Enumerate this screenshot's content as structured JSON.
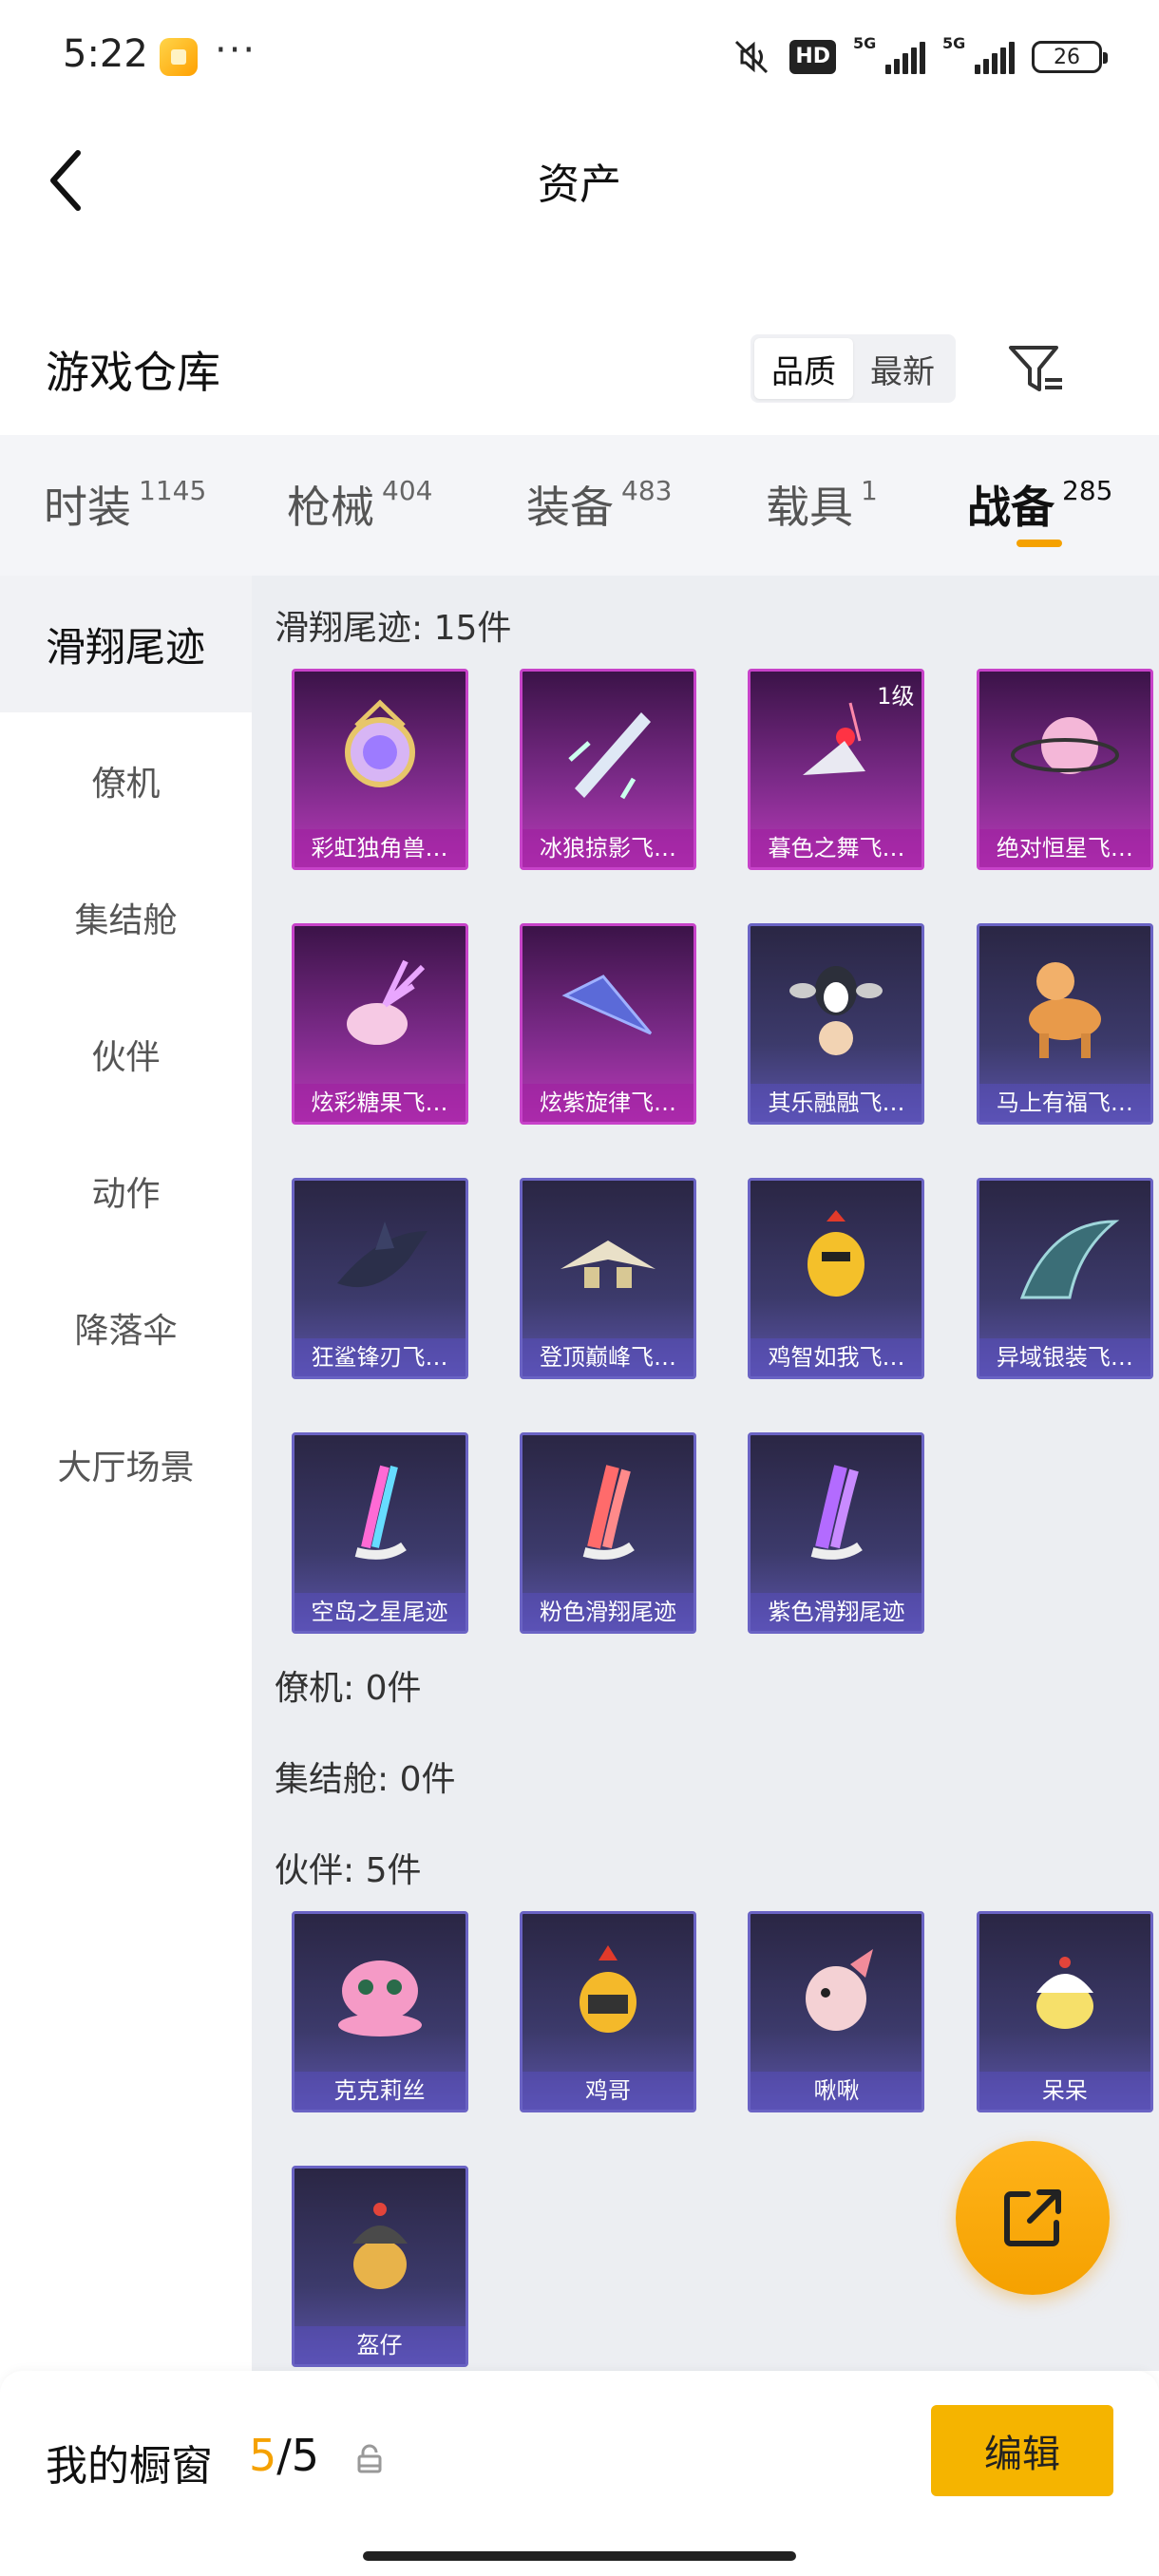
{
  "status_bar": {
    "time": "5:22",
    "dots": "···",
    "hd": "HD",
    "net1": "5G",
    "net2": "5G",
    "battery": "26"
  },
  "header": {
    "title": "资产"
  },
  "warehouse": {
    "title": "游戏仓库",
    "sort_options": [
      "品质",
      "最新"
    ],
    "active_sort": "品质"
  },
  "tabs": [
    {
      "label": "时装",
      "count": "1145"
    },
    {
      "label": "枪械",
      "count": "404"
    },
    {
      "label": "装备",
      "count": "483"
    },
    {
      "label": "载具",
      "count": "1"
    },
    {
      "label": "战备",
      "count": "285"
    }
  ],
  "active_tab": "战备",
  "sidebar": {
    "items": [
      "滑翔尾迹",
      "僚机",
      "集结舱",
      "伙伴",
      "动作",
      "降落伞",
      "大厅场景"
    ],
    "active": "滑翔尾迹"
  },
  "groups": {
    "glide_trails": {
      "label": "滑翔尾迹: 15件",
      "items": [
        {
          "name": "彩虹独角兽…",
          "rarity": "purple",
          "icon": "unicorn-charm-icon"
        },
        {
          "name": "冰狼掠影飞…",
          "rarity": "purple",
          "icon": "ice-wing-icon"
        },
        {
          "name": "暮色之舞飞…",
          "rarity": "purple",
          "icon": "dusk-dance-icon",
          "level": "1级"
        },
        {
          "name": "绝对恒星飞…",
          "rarity": "purple",
          "icon": "planet-icon"
        },
        {
          "name": "炫彩糖果飞…",
          "rarity": "purple",
          "icon": "candy-icon"
        },
        {
          "name": "炫紫旋律飞…",
          "rarity": "purple",
          "icon": "violet-glider-icon"
        },
        {
          "name": "其乐融融飞…",
          "rarity": "blue",
          "icon": "penguin-icon"
        },
        {
          "name": "马上有福飞…",
          "rarity": "blue",
          "icon": "horse-icon"
        },
        {
          "name": "狂鲨锋刃飞…",
          "rarity": "blue",
          "icon": "shark-icon"
        },
        {
          "name": "登顶巅峰飞…",
          "rarity": "blue",
          "icon": "jet-icon"
        },
        {
          "name": "鸡智如我飞…",
          "rarity": "blue",
          "icon": "chicken-icon"
        },
        {
          "name": "异域银装飞…",
          "rarity": "blue",
          "icon": "silver-wing-icon"
        },
        {
          "name": "空岛之星尾迹",
          "rarity": "blue",
          "icon": "rainbow-smoke-icon"
        },
        {
          "name": "粉色滑翔尾迹",
          "rarity": "blue",
          "icon": "pink-smoke-icon"
        },
        {
          "name": "紫色滑翔尾迹",
          "rarity": "blue",
          "icon": "purple-smoke-icon"
        }
      ]
    },
    "wingman": {
      "label": "僚机: 0件"
    },
    "pod": {
      "label": "集结舱: 0件"
    },
    "partners": {
      "label": "伙伴: 5件",
      "items": [
        {
          "name": "克克莉丝",
          "rarity": "blue",
          "icon": "octopus-icon"
        },
        {
          "name": "鸡哥",
          "rarity": "blue",
          "icon": "rooster-icon"
        },
        {
          "name": "啾啾",
          "rarity": "blue",
          "icon": "pink-bird-icon"
        },
        {
          "name": "呆呆",
          "rarity": "blue",
          "icon": "chick-icon"
        },
        {
          "name": "盔仔",
          "rarity": "blue",
          "icon": "helmet-chick-icon"
        }
      ]
    }
  },
  "bottom_bar": {
    "label": "我的橱窗",
    "current": "5",
    "sep": "/",
    "max": "5",
    "edit_label": "编辑"
  },
  "colors": {
    "accent": "#f5a100",
    "card_purple": "#b83ab8",
    "card_blue": "#5b54a8"
  }
}
